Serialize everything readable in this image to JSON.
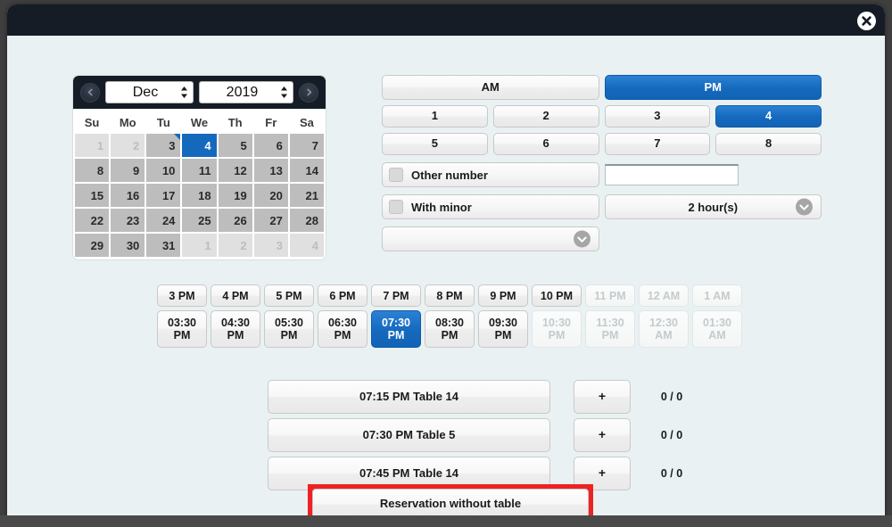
{
  "dialog": {
    "close_icon": "close-icon",
    "accent_blue": "#1569bd",
    "highlight_red": "#ee2222"
  },
  "calendar": {
    "prev_icon": "chevron-left-icon",
    "next_icon": "chevron-right-icon",
    "month": "Dec",
    "year": "2019",
    "spinner_icon": "spinner-updown-icon",
    "day_headers": [
      "Su",
      "Mo",
      "Tu",
      "We",
      "Th",
      "Fr",
      "Sa"
    ],
    "weeks": [
      [
        {
          "d": "1",
          "state": "other"
        },
        {
          "d": "2",
          "state": "other"
        },
        {
          "d": "3",
          "state": "marked"
        },
        {
          "d": "4",
          "state": "selected"
        },
        {
          "d": "5",
          "state": "normal"
        },
        {
          "d": "6",
          "state": "normal"
        },
        {
          "d": "7",
          "state": "normal"
        }
      ],
      [
        {
          "d": "8",
          "state": "normal"
        },
        {
          "d": "9",
          "state": "normal"
        },
        {
          "d": "10",
          "state": "normal"
        },
        {
          "d": "11",
          "state": "normal"
        },
        {
          "d": "12",
          "state": "normal"
        },
        {
          "d": "13",
          "state": "normal"
        },
        {
          "d": "14",
          "state": "normal"
        }
      ],
      [
        {
          "d": "15",
          "state": "normal"
        },
        {
          "d": "16",
          "state": "normal"
        },
        {
          "d": "17",
          "state": "normal"
        },
        {
          "d": "18",
          "state": "normal"
        },
        {
          "d": "19",
          "state": "normal"
        },
        {
          "d": "20",
          "state": "normal"
        },
        {
          "d": "21",
          "state": "normal"
        }
      ],
      [
        {
          "d": "22",
          "state": "normal"
        },
        {
          "d": "23",
          "state": "normal"
        },
        {
          "d": "24",
          "state": "normal"
        },
        {
          "d": "25",
          "state": "normal"
        },
        {
          "d": "26",
          "state": "normal"
        },
        {
          "d": "27",
          "state": "normal"
        },
        {
          "d": "28",
          "state": "normal"
        }
      ],
      [
        {
          "d": "29",
          "state": "normal"
        },
        {
          "d": "30",
          "state": "normal"
        },
        {
          "d": "31",
          "state": "normal"
        },
        {
          "d": "1",
          "state": "other"
        },
        {
          "d": "2",
          "state": "other"
        },
        {
          "d": "3",
          "state": "other"
        },
        {
          "d": "4",
          "state": "other"
        }
      ]
    ]
  },
  "meridiem": {
    "am_label": "AM",
    "pm_label": "PM",
    "selected": "PM"
  },
  "party_size": {
    "row1": [
      {
        "label": "1",
        "selected": false
      },
      {
        "label": "2",
        "selected": false
      },
      {
        "label": "3",
        "selected": false
      },
      {
        "label": "4",
        "selected": true
      }
    ],
    "row2": [
      {
        "label": "5",
        "selected": false
      },
      {
        "label": "6",
        "selected": false
      },
      {
        "label": "7",
        "selected": false
      },
      {
        "label": "8",
        "selected": false
      }
    ]
  },
  "options": {
    "other_number_label": "Other number",
    "other_number_value": "",
    "other_number_placeholder": "",
    "with_minor_label": "With minor",
    "duration_value": "2 hour(s)",
    "minor_select_value": "",
    "chevron_icon": "chevron-down-circle-icon",
    "checkbox_icon": "checkbox-unchecked-icon"
  },
  "hour_tabs": [
    {
      "label": "3 PM",
      "state": "normal"
    },
    {
      "label": "4 PM",
      "state": "normal"
    },
    {
      "label": "5 PM",
      "state": "normal"
    },
    {
      "label": "6 PM",
      "state": "normal"
    },
    {
      "label": "7 PM",
      "state": "normal"
    },
    {
      "label": "8 PM",
      "state": "normal"
    },
    {
      "label": "9 PM",
      "state": "normal"
    },
    {
      "label": "10 PM",
      "state": "normal"
    },
    {
      "label": "11 PM",
      "state": "disabled"
    },
    {
      "label": "12 AM",
      "state": "disabled"
    },
    {
      "label": "1 AM",
      "state": "disabled"
    }
  ],
  "half_hour_tabs": [
    {
      "l1": "03:30",
      "l2": "PM",
      "state": "normal"
    },
    {
      "l1": "04:30",
      "l2": "PM",
      "state": "normal"
    },
    {
      "l1": "05:30",
      "l2": "PM",
      "state": "normal"
    },
    {
      "l1": "06:30",
      "l2": "PM",
      "state": "normal"
    },
    {
      "l1": "07:30",
      "l2": "PM",
      "state": "selected"
    },
    {
      "l1": "08:30",
      "l2": "PM",
      "state": "normal"
    },
    {
      "l1": "09:30",
      "l2": "PM",
      "state": "normal"
    },
    {
      "l1": "10:30",
      "l2": "PM",
      "state": "disabled"
    },
    {
      "l1": "11:30",
      "l2": "PM",
      "state": "disabled"
    },
    {
      "l1": "12:30",
      "l2": "AM",
      "state": "disabled"
    },
    {
      "l1": "01:30",
      "l2": "AM",
      "state": "disabled"
    }
  ],
  "table_rows": [
    {
      "label": "07:15 PM Table 14",
      "plus": "+",
      "count": "0 / 0"
    },
    {
      "label": "07:30 PM Table 5",
      "plus": "+",
      "count": "0 / 0"
    },
    {
      "label": "07:45 PM Table 14",
      "plus": "+",
      "count": "0 / 0"
    }
  ],
  "cta": {
    "label": "Reservation without table"
  }
}
